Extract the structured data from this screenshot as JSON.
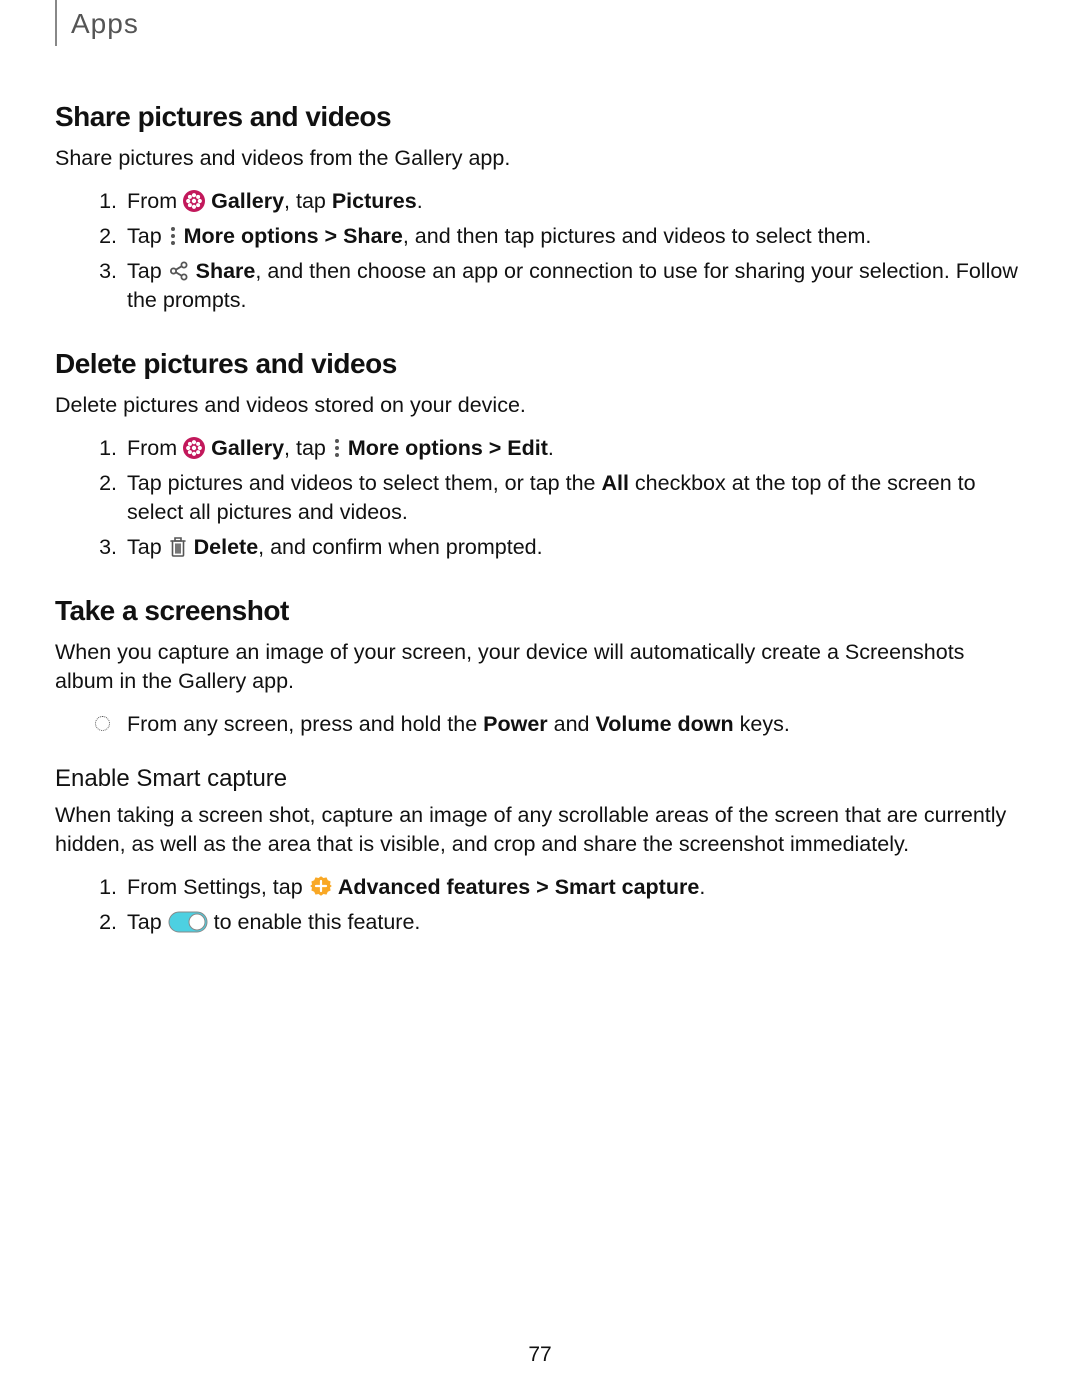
{
  "header": {
    "section": "Apps"
  },
  "footer": {
    "page": "77"
  },
  "share": {
    "heading": "Share pictures and videos",
    "intro": "Share pictures and videos from the Gallery app.",
    "step1_a": "From ",
    "step1_b": " Gallery",
    "step1_c": ", tap ",
    "step1_d": "Pictures",
    "step1_e": ".",
    "step2_a": "Tap ",
    "step2_b": " More options",
    "step2_c": " > ",
    "step2_d": "Share",
    "step2_e": ", and then tap pictures and videos to select them.",
    "step3_a": "Tap ",
    "step3_b": " Share",
    "step3_c": ", and then choose an app or connection to use for sharing your selection. Follow the prompts."
  },
  "delete": {
    "heading": "Delete pictures and videos",
    "intro": "Delete pictures and videos stored on your device.",
    "step1_a": "From ",
    "step1_b": " Gallery",
    "step1_c": ", tap ",
    "step1_d": " More options",
    "step1_e": " > ",
    "step1_f": "Edit",
    "step1_g": ".",
    "step2_a": "Tap pictures and videos to select them, or tap the ",
    "step2_b": "All",
    "step2_c": " checkbox at the top of the screen to select all pictures and videos.",
    "step3_a": "Tap ",
    "step3_b": " Delete",
    "step3_c": ", and confirm when prompted."
  },
  "screenshot": {
    "heading": "Take a screenshot",
    "intro": "When you capture an image of your screen, your device will automatically create a Screenshots album in the Gallery app.",
    "bullet_a": "From any screen, press and hold the ",
    "bullet_b": "Power",
    "bullet_c": " and ",
    "bullet_d": "Volume down",
    "bullet_e": " keys."
  },
  "smart": {
    "heading": "Enable Smart capture",
    "intro": "When taking a screen shot, capture an image of any scrollable areas of the screen that are currently hidden, as well as the area that is visible, and crop and share the screenshot immediately.",
    "step1_a": "From Settings, tap ",
    "step1_b": " Advanced features",
    "step1_c": " > ",
    "step1_d": "Smart capture",
    "step1_e": ".",
    "step2_a": "Tap ",
    "step2_b": " to enable this feature."
  }
}
